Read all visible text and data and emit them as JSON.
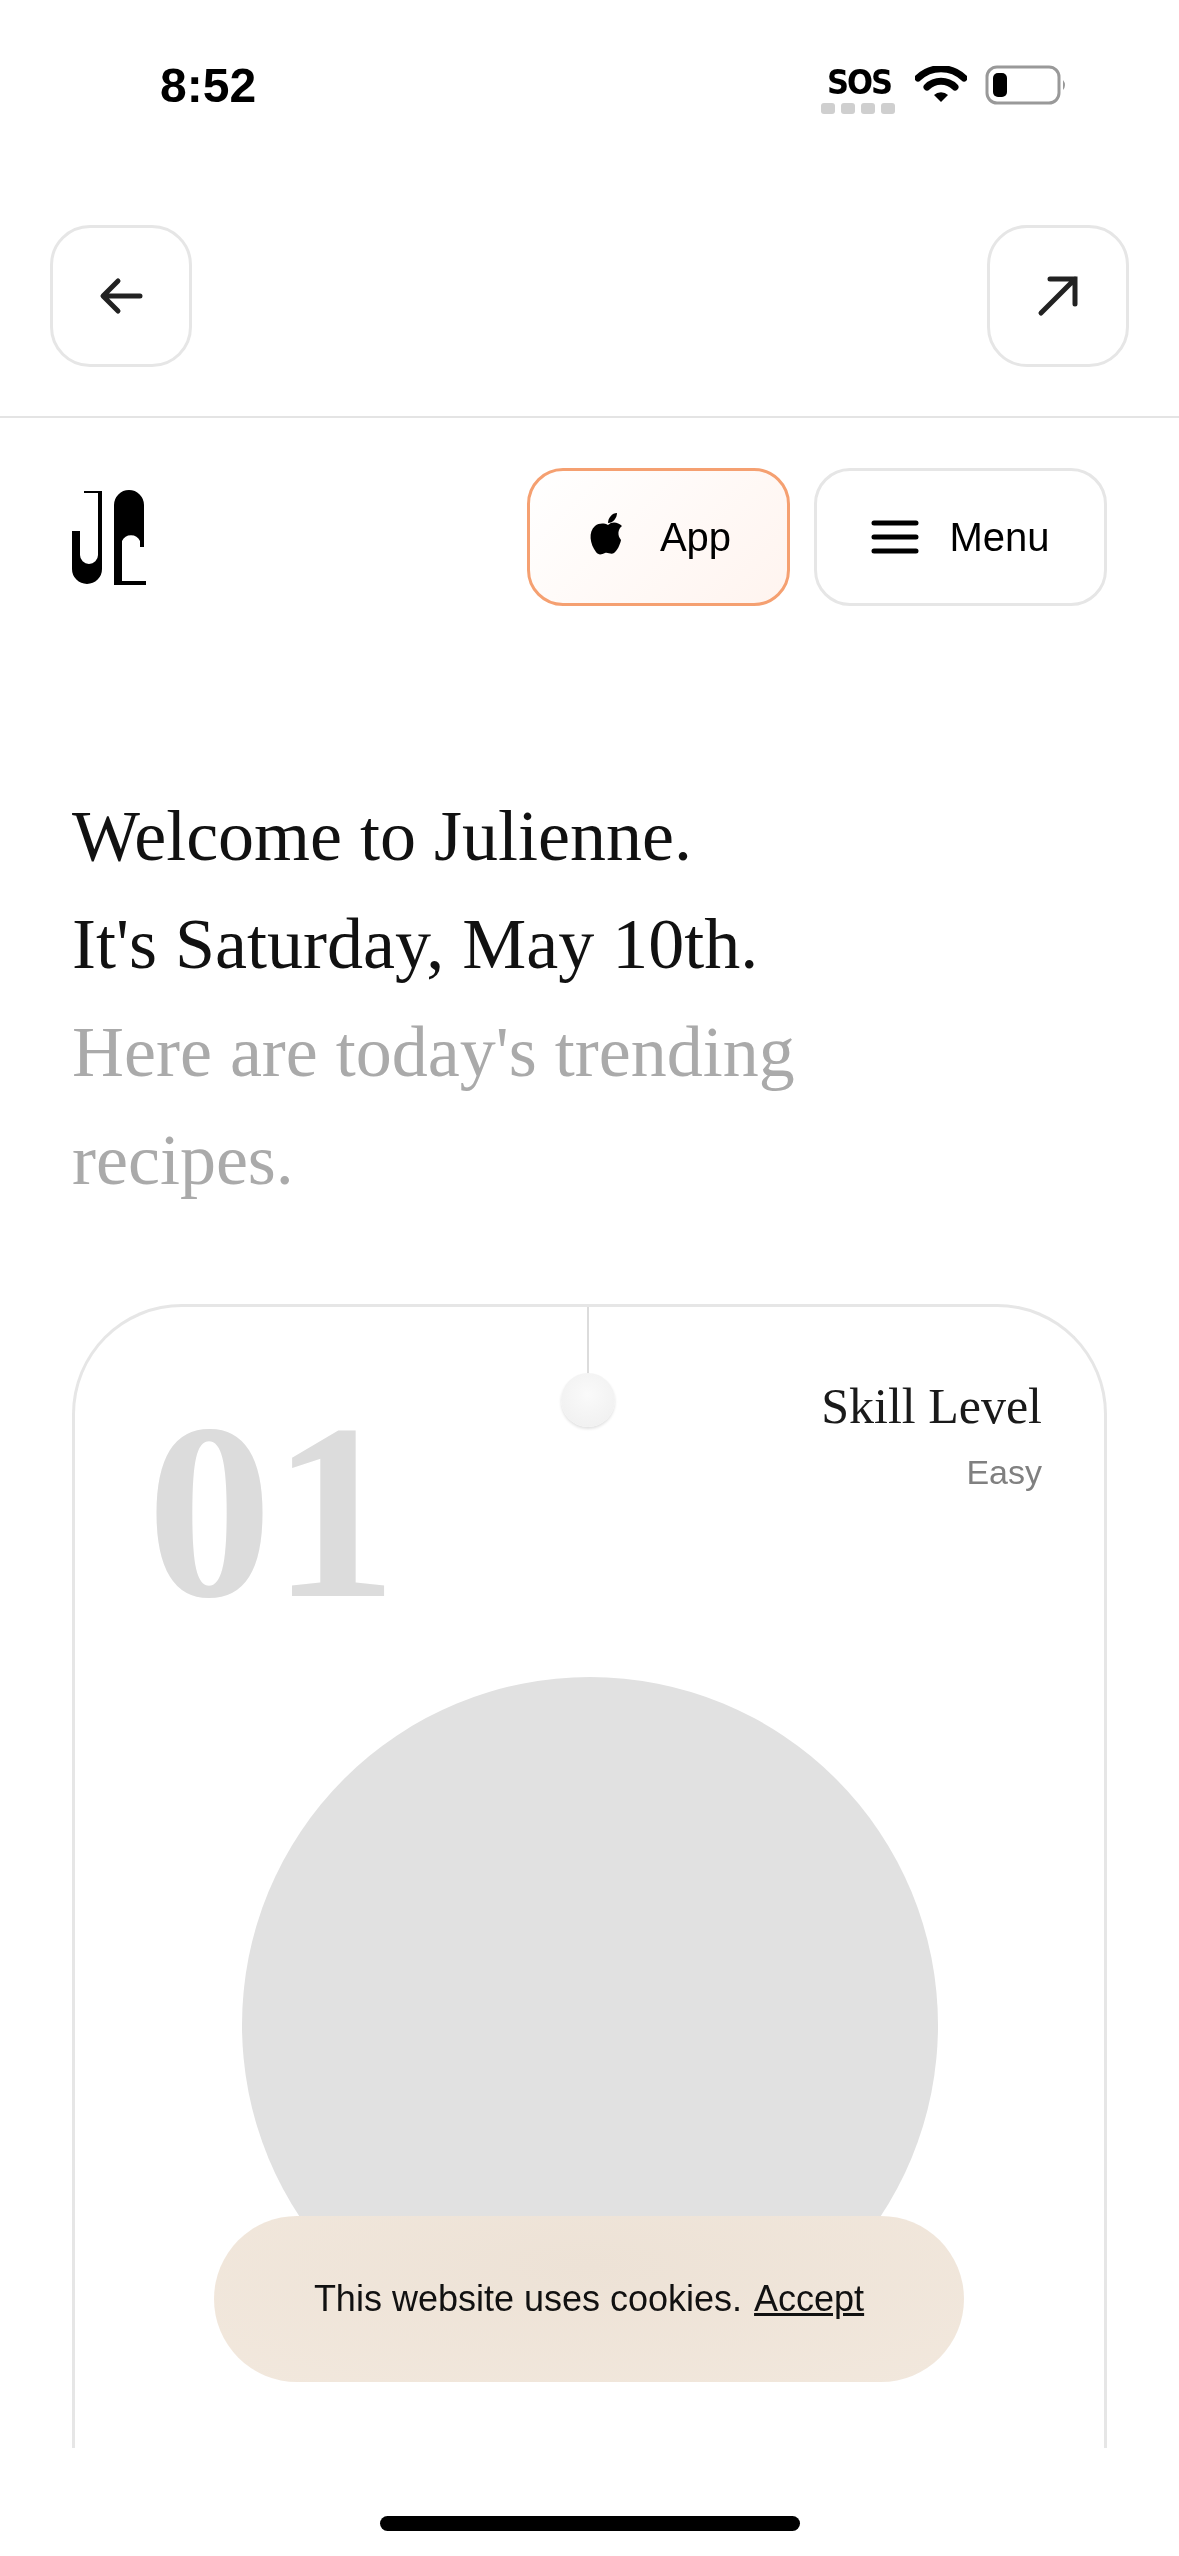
{
  "status_bar": {
    "time": "8:52",
    "sos": "SOS"
  },
  "header": {
    "buttons": [
      {
        "kind": "app",
        "label": "App"
      },
      {
        "kind": "menu",
        "label": "Menu"
      }
    ]
  },
  "greeting": {
    "lines": [
      "Welcome to Julienne.",
      "It's Saturday, May 10th."
    ],
    "subtitle": "Here are today's trending recipes."
  },
  "recipes": [
    {
      "rank": "01",
      "skill_label": "Skill Level",
      "skill": "Easy"
    }
  ],
  "cookie_banner": {
    "message": "This website uses cookies.",
    "link": "Accept"
  }
}
